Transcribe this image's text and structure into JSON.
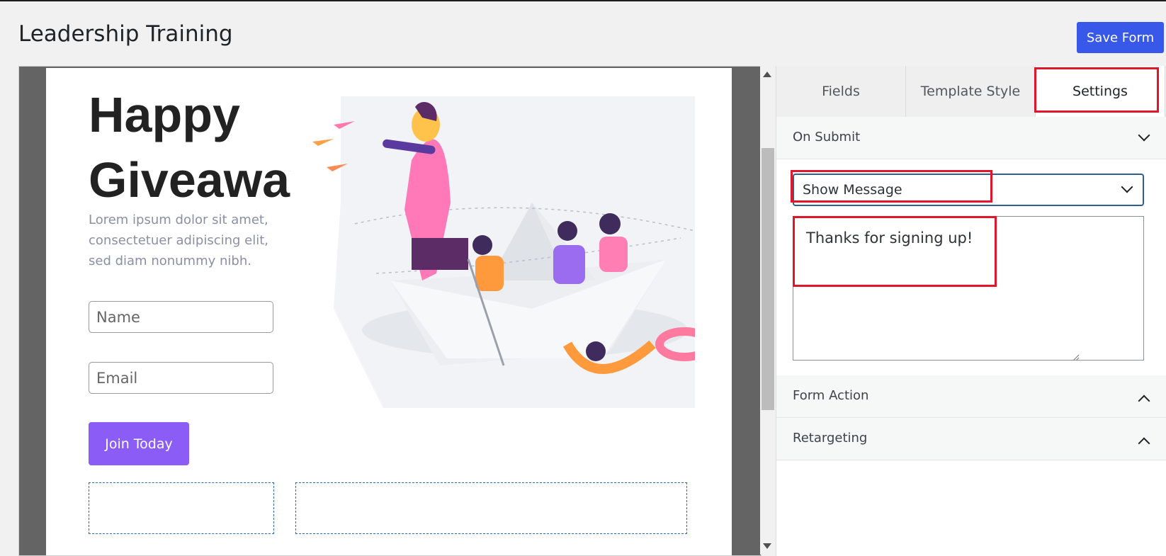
{
  "page": {
    "title": "Leadership Training",
    "save_label": "Save Form"
  },
  "preview": {
    "headline_line1": "Happy",
    "headline_line2": "Giveaway",
    "lorem": "Lorem ipsum dolor sit amet, consectetuer adipiscing elit, sed diam nonummy nibh.",
    "name_placeholder": "Name",
    "email_placeholder": "Email",
    "join_label": "Join Today"
  },
  "panel": {
    "tabs": [
      {
        "label": "Fields"
      },
      {
        "label": "Template Style"
      },
      {
        "label": "Settings"
      }
    ],
    "active_tab": "Settings",
    "on_submit": {
      "title": "On Submit",
      "selected_option": "Show Message",
      "message": "Thanks for signing up!"
    },
    "form_action_title": "Form Action",
    "retargeting_title": "Retargeting"
  },
  "colors": {
    "primary": "#3858e9",
    "join_button": "#8b5cf6",
    "highlight": "#e0162b"
  }
}
